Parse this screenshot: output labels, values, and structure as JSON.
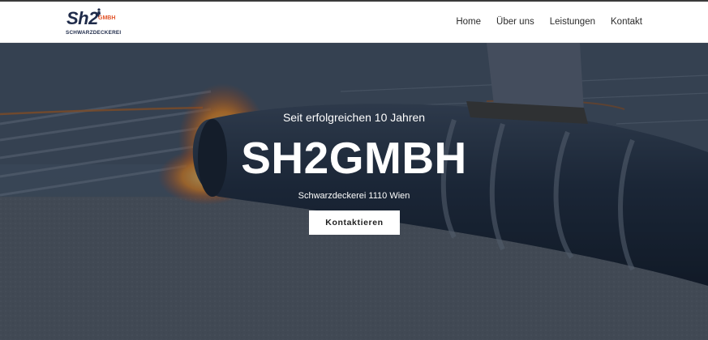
{
  "brand": {
    "logo_main": "Sh2",
    "logo_suffix": "GMBH",
    "logo_sub": "SCHWARZDECKEREI"
  },
  "nav": {
    "items": [
      "Home",
      "Über uns",
      "Leistungen",
      "Kontakt"
    ]
  },
  "hero": {
    "tagline": "Seit erfolgreichen 10 Jahren",
    "title": "SH2GMBH",
    "subtitle": "Schwarzdeckerei 1110 Wien",
    "cta_label": "Kontaktieren"
  },
  "colors": {
    "brand_navy": "#1f2b4a",
    "brand_orange": "#e2552a",
    "overlay": "#142034"
  }
}
